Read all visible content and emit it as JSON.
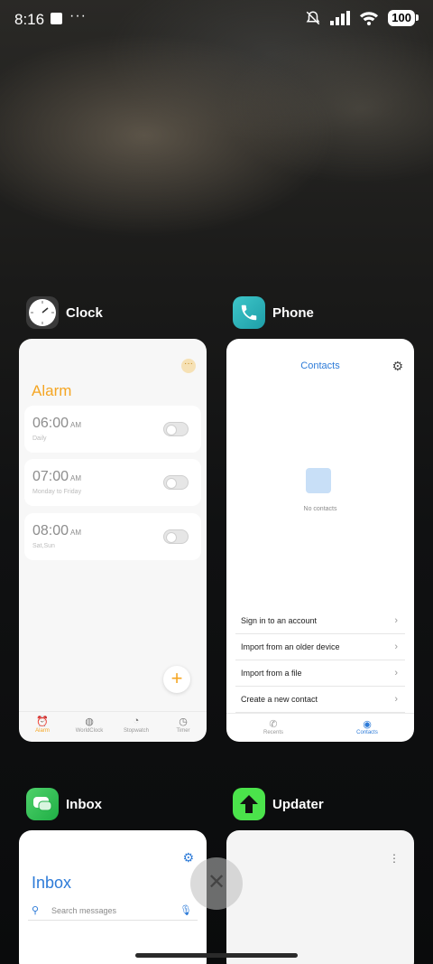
{
  "status_bar": {
    "time": "8:16",
    "dots": "···",
    "battery": "100"
  },
  "apps": {
    "clock": {
      "name": "Clock",
      "title": "Alarm",
      "alarms": [
        {
          "time": "06:00",
          "ampm": "AM",
          "repeat": "Daily"
        },
        {
          "time": "07:00",
          "ampm": "AM",
          "repeat": "Monday to Friday"
        },
        {
          "time": "08:00",
          "ampm": "AM",
          "repeat": "Sat,Sun"
        }
      ],
      "tabs": [
        "Alarm",
        "WorldClock",
        "Stopwatch",
        "Timer"
      ],
      "active_tab": "Alarm",
      "accent": "#f5a623"
    },
    "phone": {
      "name": "Phone",
      "title": "Contacts",
      "empty_text": "No contacts",
      "rows": [
        "Sign in to an account",
        "Import from an older device",
        "Import from a file",
        "Create a new contact"
      ],
      "tabs": [
        "Recents",
        "Contacts"
      ],
      "active_tab": "Contacts",
      "accent": "#2d7bd8"
    },
    "inbox": {
      "name": "Inbox",
      "title": "Inbox",
      "search_placeholder": "Search messages"
    },
    "updater": {
      "name": "Updater"
    }
  },
  "icons": {
    "close": "close-icon",
    "settings": "gear-icon",
    "search": "search-icon",
    "mic": "mic-icon"
  }
}
